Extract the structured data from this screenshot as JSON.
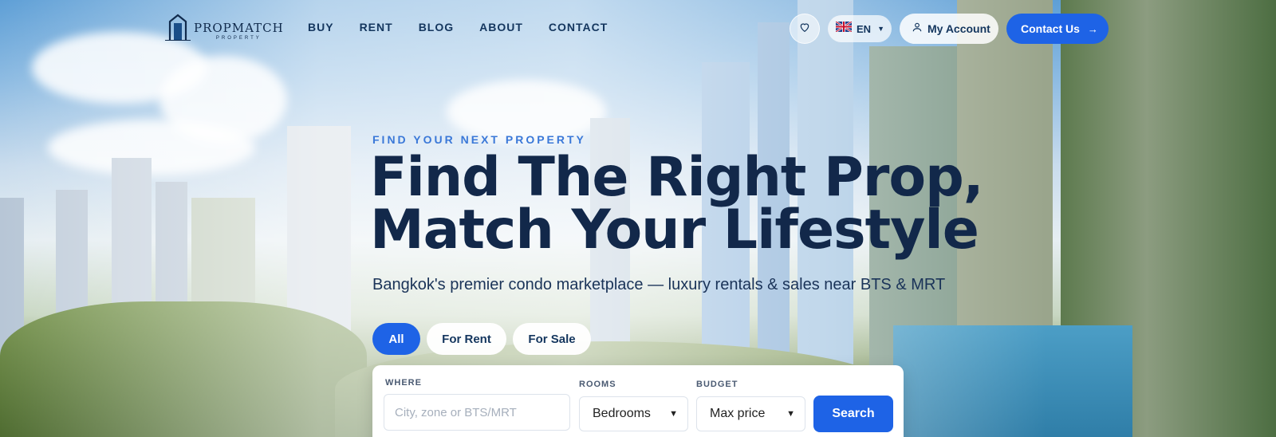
{
  "brand": {
    "name": "PROPMATCH",
    "tagline": "PROPERTY"
  },
  "nav": {
    "items": [
      {
        "label": "BUY"
      },
      {
        "label": "RENT"
      },
      {
        "label": "BLOG"
      },
      {
        "label": "ABOUT"
      },
      {
        "label": "CONTACT"
      }
    ]
  },
  "header_actions": {
    "favorites_icon": "heart-icon",
    "language_code": "EN",
    "language_flag": "uk-flag-icon",
    "account_label": "My Account",
    "contact_label": "Contact Us"
  },
  "hero": {
    "eyebrow": "FIND YOUR NEXT PROPERTY",
    "headline_line1": "Find The Right Prop,",
    "headline_line2": "Match Your Lifestyle",
    "subtitle": "Bangkok's premier condo marketplace — luxury rentals & sales near BTS & MRT"
  },
  "filters": {
    "tabs": [
      {
        "label": "All",
        "active": true
      },
      {
        "label": "For Rent",
        "active": false
      },
      {
        "label": "For Sale",
        "active": false
      }
    ]
  },
  "search": {
    "where_label": "WHERE",
    "where_placeholder": "City, zone or BTS/MRT",
    "rooms_label": "ROOMS",
    "rooms_value": "Bedrooms",
    "budget_label": "BUDGET",
    "budget_value": "Max price",
    "button_label": "Search"
  },
  "colors": {
    "accent": "#1e63e6",
    "navy": "#12284a",
    "eyebrow": "#3a78d8"
  }
}
